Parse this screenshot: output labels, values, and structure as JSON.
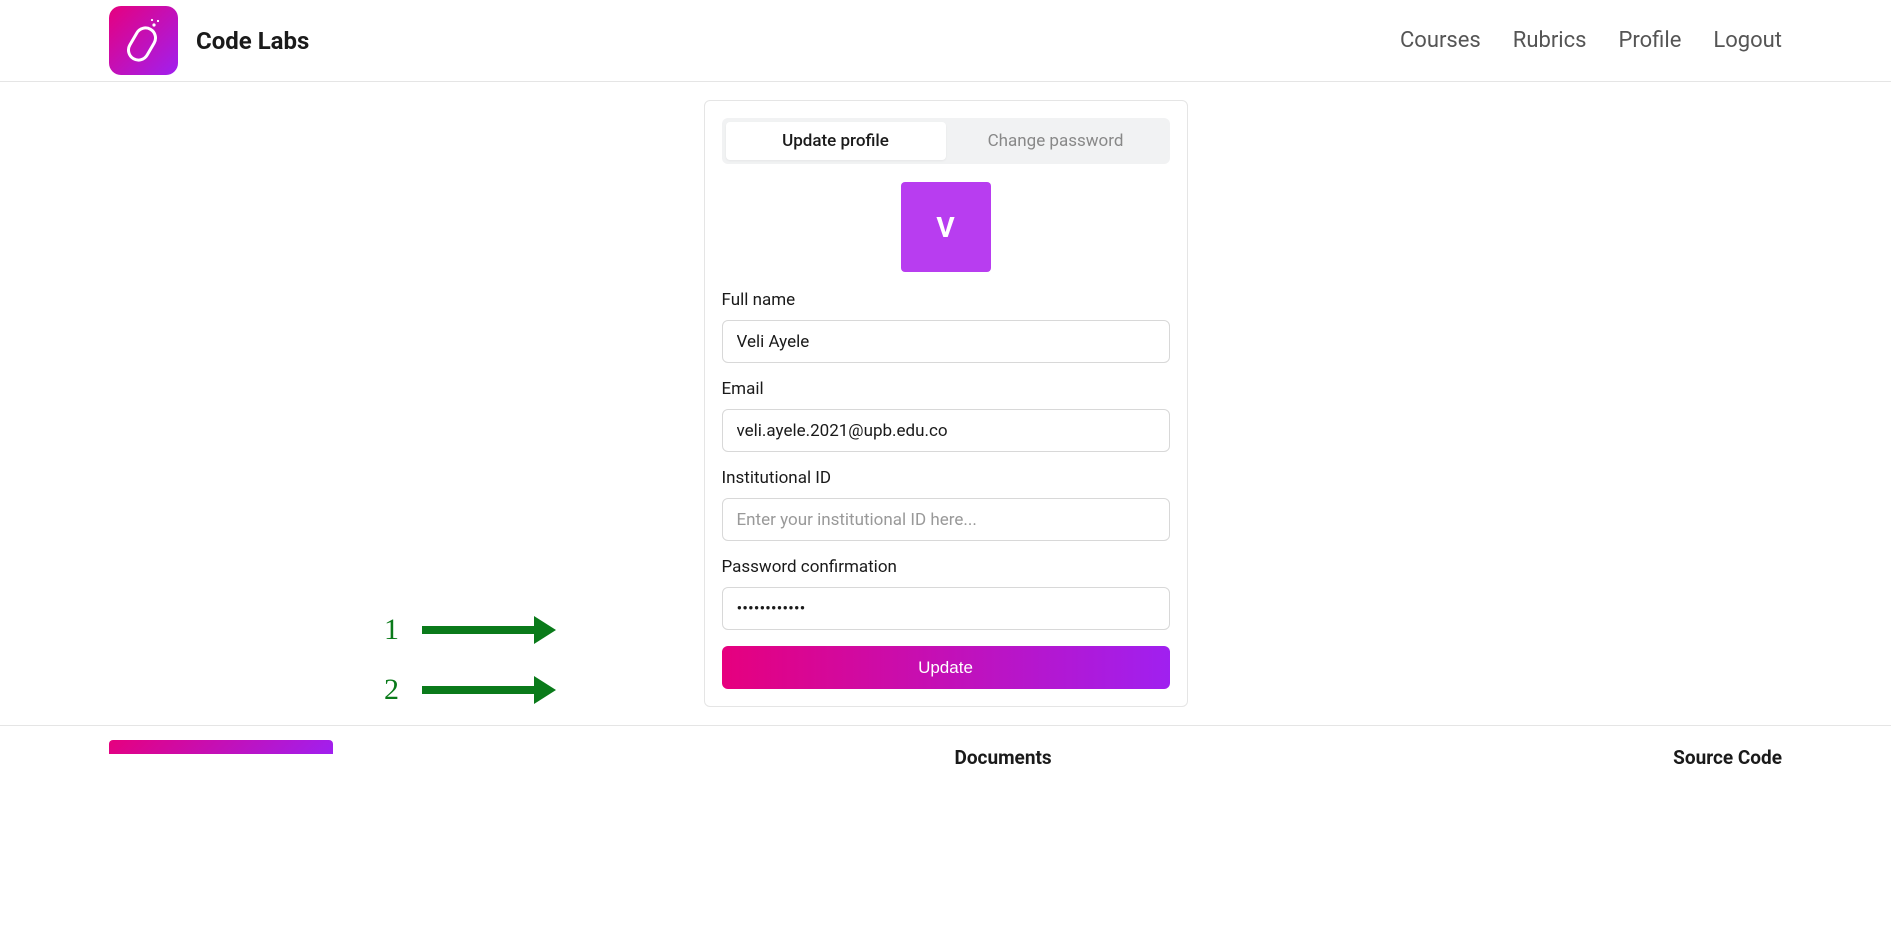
{
  "brand": {
    "name": "Code Labs"
  },
  "nav": {
    "courses": "Courses",
    "rubrics": "Rubrics",
    "profile": "Profile",
    "logout": "Logout"
  },
  "tabs": {
    "update_profile": "Update profile",
    "change_password": "Change password"
  },
  "avatar": {
    "letter": "V"
  },
  "form": {
    "full_name_label": "Full name",
    "full_name_value": "Veli Ayele",
    "email_label": "Email",
    "email_value": "veli.ayele.2021@upb.edu.co",
    "institutional_id_label": "Institutional ID",
    "institutional_id_placeholder": "Enter your institutional ID here...",
    "institutional_id_value": "",
    "password_label": "Password confirmation",
    "password_value": "••••••••••••",
    "submit_label": "Update"
  },
  "footer": {
    "col1": "Documents",
    "col2": "Source Code"
  },
  "annotations": {
    "a1": "1",
    "a2": "2"
  }
}
